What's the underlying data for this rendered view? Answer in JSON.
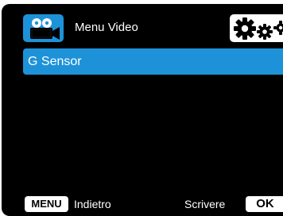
{
  "header": {
    "title": "Menu Video",
    "mode_icon": "video-camera-icon",
    "settings_icon": "settings-gears-icon"
  },
  "menu": {
    "items": [
      {
        "label": "G Sensor",
        "selected": true
      }
    ]
  },
  "footer": {
    "menu_key": "MENU",
    "back_label": "Indietro",
    "write_label": "Scrivere",
    "ok_key": "OK"
  },
  "colors": {
    "background": "#000000",
    "accent": "#1e92d8",
    "text": "#ffffff",
    "key_background": "#ffffff"
  }
}
